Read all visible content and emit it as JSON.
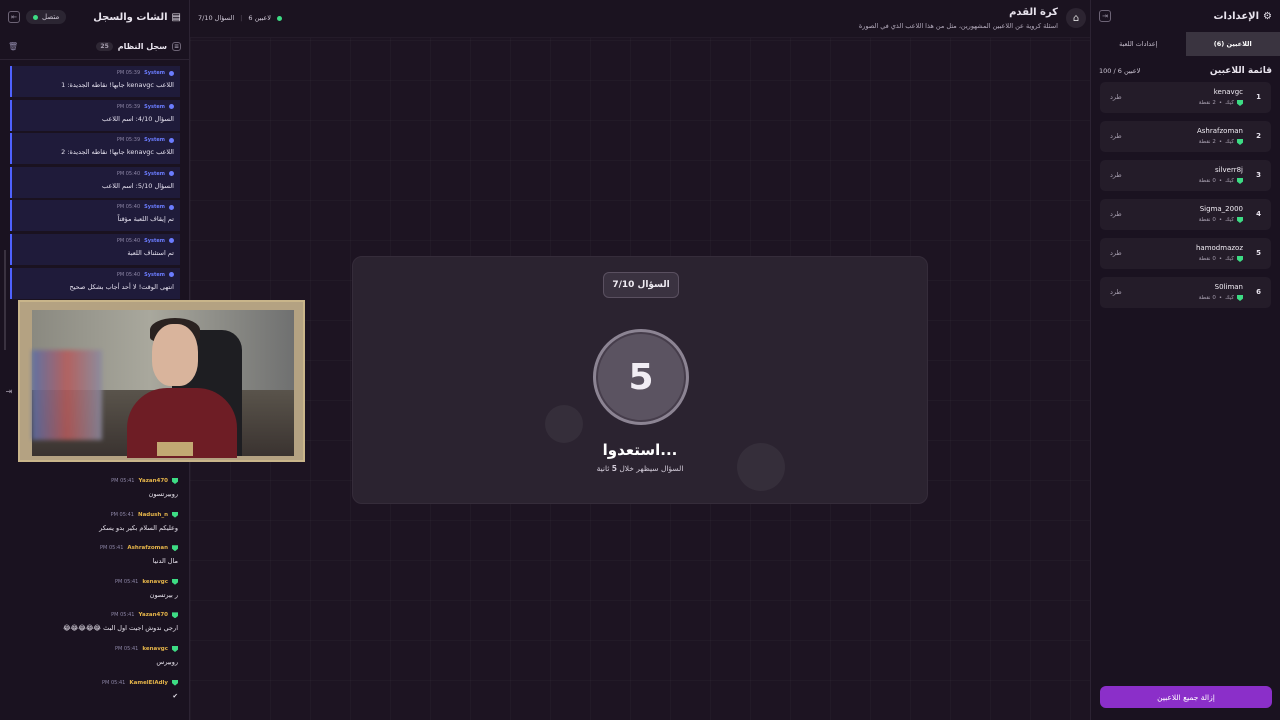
{
  "left_panel": {
    "title": "الشات والسجل",
    "status": "متصل",
    "system_log_title": "سجل النظام",
    "system_log_count": "25",
    "system_messages": [
      {
        "sender": "System",
        "time": "05:39 PM",
        "text": "اللاعب kenavgc جابها! نقاطه الجديدة: 1"
      },
      {
        "sender": "System",
        "time": "05:39 PM",
        "text": "السؤال 4/10: اسم اللاعب"
      },
      {
        "sender": "System",
        "time": "05:39 PM",
        "text": "اللاعب kenavgc جابها! نقاطه الجديدة: 2"
      },
      {
        "sender": "System",
        "time": "05:40 PM",
        "text": "السؤال 5/10: اسم اللاعب"
      },
      {
        "sender": "System",
        "time": "05:40 PM",
        "text": "تم إيقاف اللعبة مؤقتاً"
      },
      {
        "sender": "System",
        "time": "05:40 PM",
        "text": "تم استئناف اللعبة"
      },
      {
        "sender": "System",
        "time": "05:40 PM",
        "text": "انتهى الوقت! لا أحد أجاب بشكل صحيح"
      }
    ],
    "chat_messages": [
      {
        "user": "Yazan470",
        "time": "05:41 PM",
        "text": "روبيرتسون"
      },
      {
        "user": "Nadush_n",
        "time": "05:41 PM",
        "text": "وعليكم السلام بكير بدو يسكر"
      },
      {
        "user": "Ashrafzoman",
        "time": "05:41 PM",
        "text": "مال الدنيا"
      },
      {
        "user": "kenavgc",
        "time": "05:41 PM",
        "text": "ر بيرتسون"
      },
      {
        "user": "Yazan470",
        "time": "05:41 PM",
        "text": "ارجي ندوش اجيت اول البث 😂😂😂😂😂"
      },
      {
        "user": "kenavgc",
        "time": "05:41 PM",
        "text": "روبيرس"
      },
      {
        "user": "KamelElAdly",
        "time": "05:41 PM",
        "text": "✔"
      }
    ]
  },
  "topbar": {
    "title": "كرة القدم",
    "subtitle": "اسئلة كروية عن اللاعبين المشهورين، مثل من هذا اللاعب الذي في الصورة",
    "question_progress": "السؤال 7/10",
    "players_count": "6 لاعبين"
  },
  "game": {
    "question_badge": "السؤال 7/10",
    "countdown": "5",
    "ready_text": "استعدوا...",
    "hint_prefix": "السؤال سيظهر خلال",
    "hint_seconds": "5",
    "hint_suffix": "ثانية"
  },
  "right_panel": {
    "title": "الإعدادات",
    "tabs": [
      "اللاعبين (6)",
      "إعدادات اللعبة"
    ],
    "players_title": "قائمة اللاعبين",
    "players_capacity": "100 / 6 لاعبين",
    "kick_label": "طرد",
    "platform": "كيك",
    "players": [
      {
        "rank": "1",
        "name": "kenavgc",
        "points": "2 نقطة"
      },
      {
        "rank": "2",
        "name": "Ashrafzoman",
        "points": "2 نقطة"
      },
      {
        "rank": "3",
        "name": "silverr8j",
        "points": "0 نقطة"
      },
      {
        "rank": "4",
        "name": "Sigma_2000",
        "points": "0 نقطة"
      },
      {
        "rank": "5",
        "name": "hamodmazoz",
        "points": "0 نقطة"
      },
      {
        "rank": "6",
        "name": "S0liman",
        "points": "0 نقطة"
      }
    ],
    "clear_all_label": "إزالة جميع اللاعبين"
  },
  "colors": {
    "accent": "#8b2fc9",
    "online": "#3ddc84",
    "system": "#4f62ff",
    "username": "#e6b54a"
  }
}
